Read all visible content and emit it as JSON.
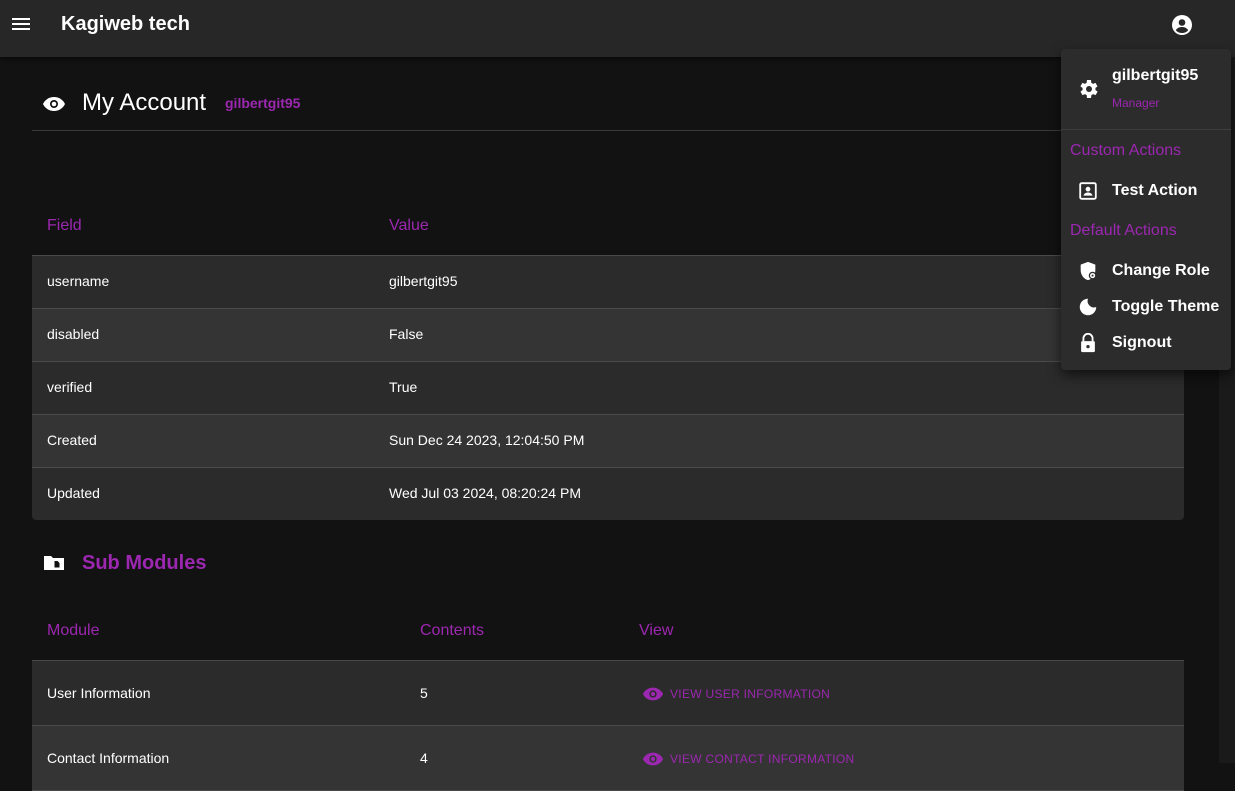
{
  "appbar": {
    "title": "Kagiweb tech"
  },
  "header": {
    "title": "My Account",
    "username": "gilbertgit95"
  },
  "fields_table": {
    "headers": [
      "Field",
      "Value"
    ],
    "rows": [
      {
        "field": "username",
        "value": "gilbertgit95"
      },
      {
        "field": "disabled",
        "value": "False"
      },
      {
        "field": "verified",
        "value": "True"
      },
      {
        "field": "Created",
        "value": "Sun Dec 24 2023, 12:04:50 PM"
      },
      {
        "field": "Updated",
        "value": "Wed Jul 03 2024, 08:20:24 PM"
      }
    ]
  },
  "sub_modules": {
    "title": "Sub Modules",
    "headers": [
      "Module",
      "Contents",
      "View"
    ],
    "rows": [
      {
        "module": "User Information",
        "contents": "5",
        "view": "VIEW USER INFORMATION"
      },
      {
        "module": "Contact Information",
        "contents": "4",
        "view": "VIEW CONTACT INFORMATION"
      }
    ]
  },
  "account_menu": {
    "username": "gilbertgit95",
    "role": "Manager",
    "custom_section": "Custom Actions",
    "custom_items": [
      {
        "label": "Test Action",
        "icon": "contact-page-icon"
      }
    ],
    "default_section": "Default Actions",
    "default_items": [
      {
        "label": "Change Role",
        "icon": "shield-icon"
      },
      {
        "label": "Toggle Theme",
        "icon": "moon-icon"
      },
      {
        "label": "Signout",
        "icon": "lock-icon"
      }
    ]
  },
  "colors": {
    "accent": "#9c27b0",
    "background": "#121212",
    "appbar": "#272727"
  }
}
